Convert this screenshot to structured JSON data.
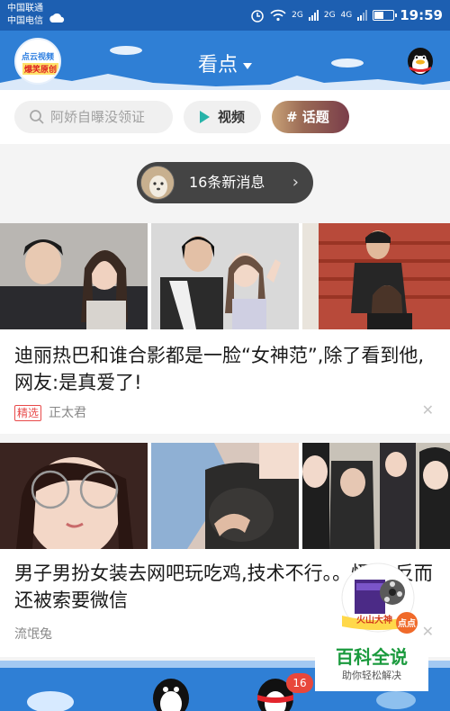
{
  "status_bar": {
    "carrier1": "中国联通",
    "carrier2": "中国电信",
    "net1": "2G",
    "net2": "2G",
    "net3": "4G",
    "time": "19:59"
  },
  "header": {
    "logo_line1": "点云视频",
    "logo_line2": "爆笑原创",
    "title": "看点"
  },
  "search": {
    "placeholder": "阿娇自曝没领证"
  },
  "quick": {
    "video_label": "视频",
    "topic_label": "# 话题"
  },
  "new_messages": {
    "text": "16条新消息",
    "chevron": "›"
  },
  "feed": [
    {
      "title": "迪丽热巴和谁合影都是一脸“女神范”,除了看到他,网友:是真爱了!",
      "badge": "精选",
      "source": "正太君",
      "close": "✕"
    },
    {
      "title": "男子男扮女装去网吧玩吃鸡,技术不行。。怪他,反而还被索要微信",
      "badge": "",
      "source": "流氓兔",
      "close": "✕"
    }
  ],
  "floating_widget": {
    "name": "火山大神",
    "action": "点点"
  },
  "watermark": {
    "line1": "百科全说",
    "line2": "助你轻松解决"
  },
  "bottom_nav": {
    "badge": "16"
  },
  "colors": {
    "header_blue": "#2f7fd5",
    "status_blue": "#1d5fb1",
    "badge_red": "#e84a4a",
    "video_teal": "#27b3a9"
  }
}
